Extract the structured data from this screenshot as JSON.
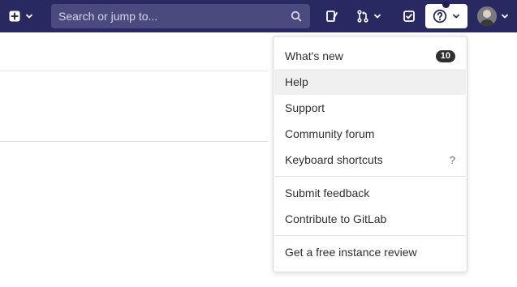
{
  "navbar": {
    "search": {
      "placeholder": "Search or jump to..."
    }
  },
  "help_menu": {
    "items": [
      {
        "label": "What's new",
        "badge": "10"
      },
      {
        "label": "Help"
      },
      {
        "label": "Support"
      },
      {
        "label": "Community forum"
      },
      {
        "label": "Keyboard shortcuts",
        "shortcut": "?"
      },
      {
        "label": "Submit feedback"
      },
      {
        "label": "Contribute to GitLab"
      },
      {
        "label": "Get a free instance review"
      }
    ]
  },
  "colors": {
    "navbar_bg": "#292961",
    "search_bg": "#4a4a7f",
    "menu_hover": "#f0f0f0"
  }
}
